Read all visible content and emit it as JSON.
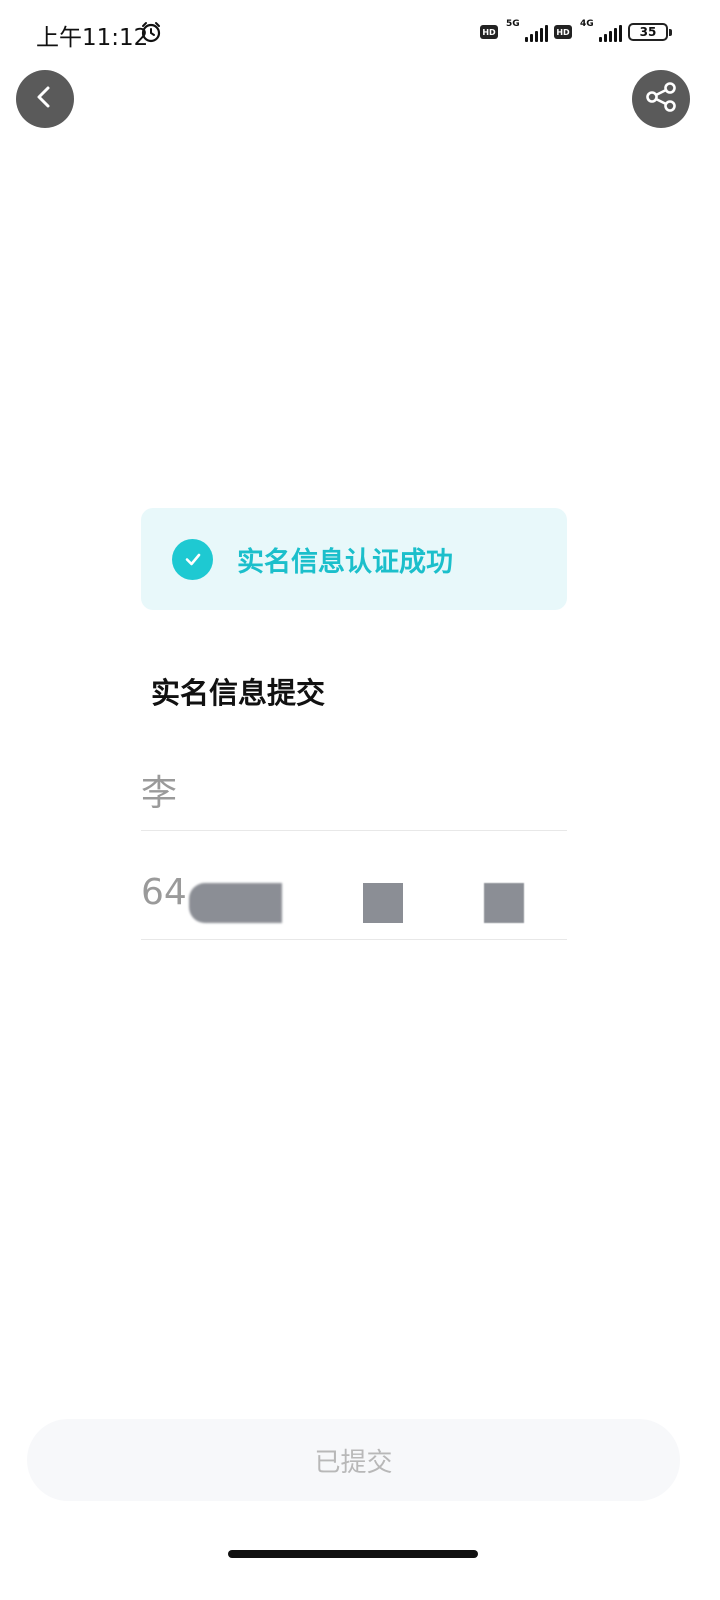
{
  "status_bar": {
    "time": "上午11:12",
    "hd1": "HD",
    "network1": "5G",
    "hd2": "HD",
    "network2": "4G",
    "battery": "35"
  },
  "nav": {
    "back_icon": "chevron-left-icon",
    "share_icon": "share-icon"
  },
  "banner": {
    "text": "实名信息认证成功",
    "accent_color": "#1EC9D2"
  },
  "form": {
    "title": "实名信息提交",
    "name_value": "李",
    "id_value": "64"
  },
  "submit": {
    "label": "已提交"
  }
}
